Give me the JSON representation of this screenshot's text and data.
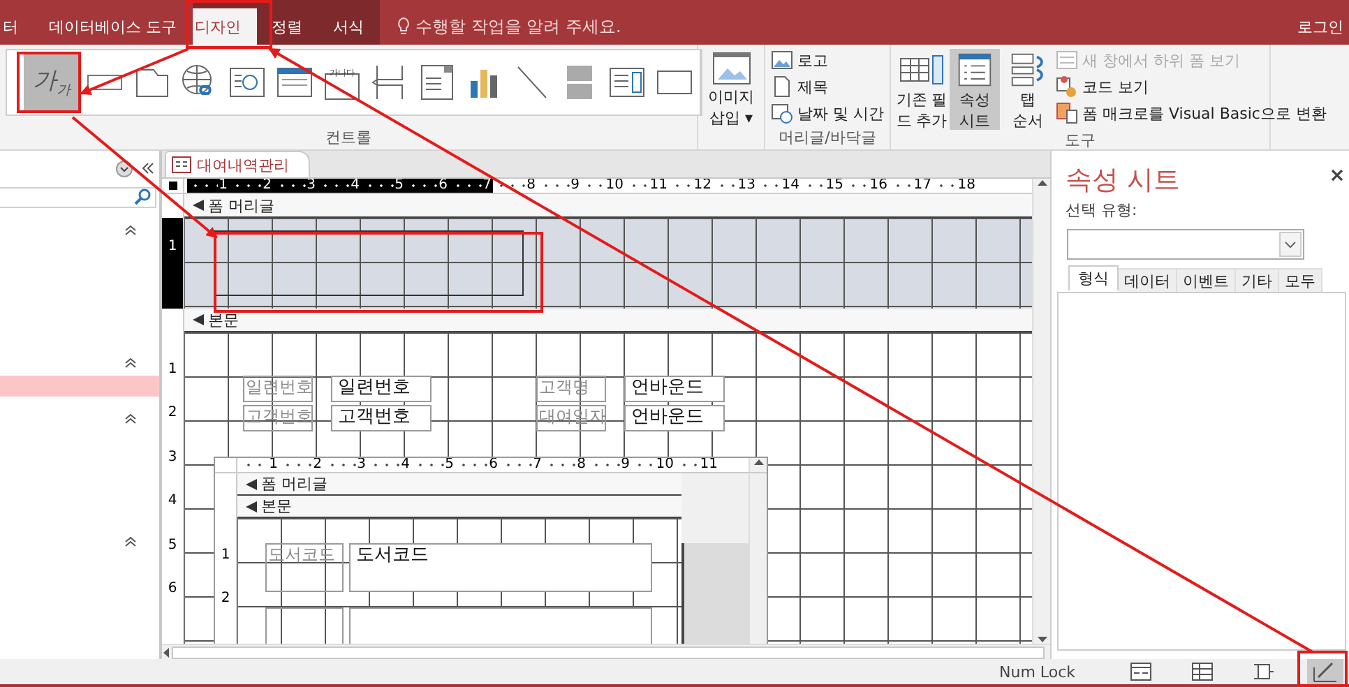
{
  "ribbon_tabs": [
    {
      "label": "터",
      "selected": false,
      "contextual": false
    },
    {
      "label": "데이터베이스 도구",
      "selected": false,
      "contextual": false
    },
    {
      "label": "디자인",
      "selected": true,
      "contextual": true
    },
    {
      "label": "정렬",
      "selected": false,
      "contextual": true
    },
    {
      "label": "서식",
      "selected": false,
      "contextual": true
    }
  ],
  "tell_me": {
    "placeholder": "수행할 작업을 알려 주세요."
  },
  "sign_in": "로그인",
  "controls_group": {
    "label": "컨트롤",
    "tools": [
      {
        "kind": "label",
        "text": "가$_{가}$",
        "selected": true
      },
      {
        "kind": "button",
        "selected": false
      },
      {
        "kind": "tab",
        "selected": false
      },
      {
        "kind": "hyperlink",
        "selected": false
      },
      {
        "kind": "browser",
        "selected": false
      },
      {
        "kind": "navigation",
        "selected": false
      },
      {
        "kind": "option-group",
        "text": "가나다",
        "selected": false
      },
      {
        "kind": "page-break",
        "selected": false
      },
      {
        "kind": "combo",
        "selected": false
      },
      {
        "kind": "chart",
        "selected": false
      },
      {
        "kind": "line",
        "selected": false
      },
      {
        "kind": "toggle",
        "selected": false
      },
      {
        "kind": "listbox",
        "selected": false
      },
      {
        "kind": "rectangle",
        "selected": false
      }
    ]
  },
  "image_insert": {
    "lines": [
      "이미지",
      "삽입 ▾"
    ]
  },
  "header_footer": {
    "label": "머리글/바닥글",
    "items": [
      {
        "kind": "logo",
        "label": "로고"
      },
      {
        "kind": "title",
        "label": "제목"
      },
      {
        "kind": "datetime",
        "label": "날짜 및 시간"
      }
    ]
  },
  "tools": {
    "label": "도구",
    "large": [
      {
        "kind": "add-fields",
        "lines": [
          "기존 필",
          "드 추가"
        ],
        "selected": false
      },
      {
        "kind": "property-sheet",
        "lines": [
          "속성",
          "시트"
        ],
        "selected": true
      },
      {
        "kind": "tab-order",
        "lines": [
          "탭",
          "순서"
        ],
        "selected": false
      }
    ],
    "small": [
      {
        "kind": "subform",
        "label": "새 창에서 하위 폼 보기",
        "disabled": true
      },
      {
        "kind": "code",
        "label": "코드 보기",
        "disabled": false
      },
      {
        "kind": "macro",
        "label": "폼 매크로를 Visual Basic으로 변환",
        "disabled": false
      }
    ]
  },
  "nav_pane": {
    "groups": [
      {
        "expanded": true
      },
      {
        "expanded": true,
        "rows": [
          {
            "selected": true
          }
        ]
      },
      {
        "expanded": true
      },
      {
        "expanded": true
      }
    ]
  },
  "document": {
    "tab": "대여내역관리",
    "ruler": [
      {
        "text": "1",
        "highlighted": true
      },
      {
        "text": "2",
        "highlighted": true
      },
      {
        "text": "3",
        "highlighted": true
      },
      {
        "text": "4",
        "highlighted": true
      },
      {
        "text": "5",
        "highlighted": true
      },
      {
        "text": "6",
        "highlighted": true
      },
      {
        "text": "7",
        "highlighted": true
      },
      {
        "text": "8",
        "highlighted": false
      },
      {
        "text": "9",
        "highlighted": false
      },
      {
        "text": "10",
        "highlighted": false
      },
      {
        "text": "11",
        "highlighted": false
      },
      {
        "text": "12",
        "highlighted": false
      },
      {
        "text": "13",
        "highlighted": false
      },
      {
        "text": "14",
        "highlighted": false
      },
      {
        "text": "15",
        "highlighted": false
      },
      {
        "text": "16",
        "highlighted": false
      },
      {
        "text": "17",
        "highlighted": false
      },
      {
        "text": "18",
        "highlighted": false
      }
    ],
    "header": {
      "title": "폼 머리글",
      "ruler": [
        "1"
      ]
    },
    "detail": {
      "title": "본문",
      "ruler": [
        "1",
        "2",
        "3",
        "4",
        "5",
        "6"
      ],
      "controls": [
        {
          "label": "일련번호",
          "field": "일련번호"
        },
        {
          "label": "고객번호",
          "field": "고객번호"
        },
        {
          "label": "고객명",
          "field": "언바운드"
        },
        {
          "label": "대여일자",
          "field": "언바운드"
        }
      ]
    },
    "subform": {
      "ruler": [
        "1",
        "2",
        "3",
        "4",
        "5",
        "6",
        "7",
        "8",
        "9",
        "10",
        "11"
      ],
      "header_title": "폼 머리글",
      "detail_title": "본문",
      "detail_ruler": [
        "1",
        "2"
      ],
      "controls": [
        {
          "label": "도서코드",
          "field": "도서코드"
        }
      ]
    }
  },
  "property_sheet": {
    "title": "속성 시트",
    "selection_type_label": "선택 유형:",
    "tabs": [
      {
        "label": "형식",
        "selected": true
      },
      {
        "label": "데이터",
        "selected": false
      },
      {
        "label": "이벤트",
        "selected": false
      },
      {
        "label": "기타",
        "selected": false
      },
      {
        "label": "모두",
        "selected": false
      }
    ]
  },
  "status_bar": {
    "text": "Num Lock",
    "views": [
      {
        "kind": "form",
        "selected": false
      },
      {
        "kind": "datasheet",
        "selected": false
      },
      {
        "kind": "layout",
        "selected": false
      },
      {
        "kind": "design",
        "selected": true
      }
    ]
  }
}
